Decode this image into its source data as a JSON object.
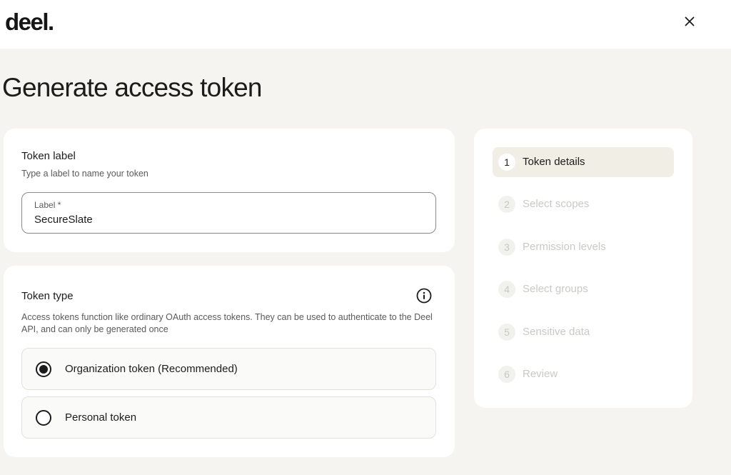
{
  "header": {
    "logo": "deel.",
    "close_icon": "close-icon"
  },
  "page": {
    "title": "Generate access token"
  },
  "token_label_section": {
    "title": "Token label",
    "subtitle": "Type a label to name your token",
    "field_label": "Label *",
    "field_value": "SecureSlate"
  },
  "token_type_section": {
    "title": "Token type",
    "info_icon": "info-icon",
    "description": "Access tokens function like ordinary OAuth access tokens. They can be used to authenticate to the Deel API, and can only be generated once",
    "options": [
      {
        "label": "Organization token (Recommended)",
        "selected": true
      },
      {
        "label": "Personal token",
        "selected": false
      }
    ]
  },
  "steps": [
    {
      "number": "1",
      "label": "Token details",
      "active": true
    },
    {
      "number": "2",
      "label": "Select scopes",
      "active": false
    },
    {
      "number": "3",
      "label": "Permission levels",
      "active": false
    },
    {
      "number": "4",
      "label": "Select groups",
      "active": false
    },
    {
      "number": "5",
      "label": "Sensitive data",
      "active": false
    },
    {
      "number": "6",
      "label": "Review",
      "active": false
    }
  ],
  "colors": {
    "page_bg": "#f5f4f0",
    "card_bg": "#ffffff",
    "active_step_bg": "#f1eee6",
    "inactive_text": "#c9c9c6",
    "primary_text": "#1c1c1c"
  }
}
